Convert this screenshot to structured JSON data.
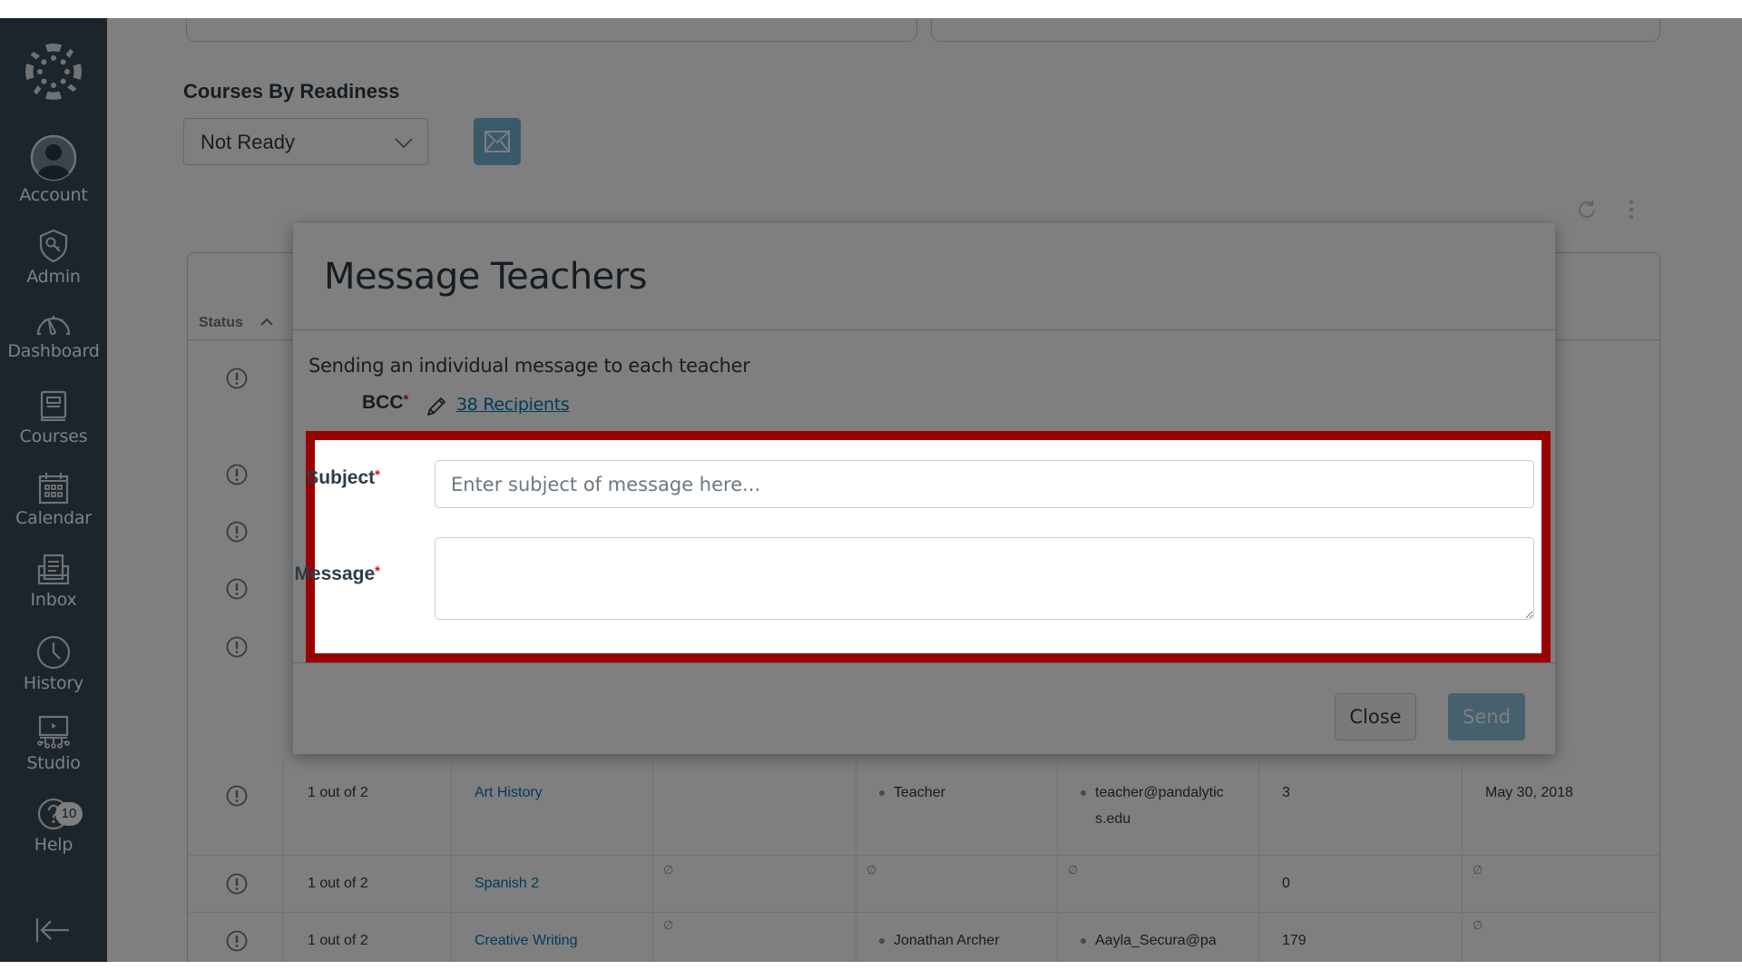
{
  "sidebar": {
    "logo_icon": "canvas-logo-icon",
    "items": [
      {
        "label": "Account",
        "icon": "account-icon"
      },
      {
        "label": "Admin",
        "icon": "admin-shield-icon"
      },
      {
        "label": "Dashboard",
        "icon": "dashboard-gauge-icon"
      },
      {
        "label": "Courses",
        "icon": "courses-book-icon"
      },
      {
        "label": "Calendar",
        "icon": "calendar-icon"
      },
      {
        "label": "Inbox",
        "icon": "inbox-icon"
      },
      {
        "label": "History",
        "icon": "history-clock-icon"
      },
      {
        "label": "Studio",
        "icon": "studio-icon"
      },
      {
        "label": "Help",
        "icon": "help-icon",
        "badge": "10"
      }
    ],
    "collapse_icon": "collapse-arrow-icon"
  },
  "main": {
    "section_title": "Courses By Readiness",
    "readiness_filter": {
      "selected": "Not Ready"
    },
    "email_button_icon": "envelope-icon",
    "toolbar_icons": [
      "refresh-icon",
      "more-vertical-icon"
    ],
    "table": {
      "sort_column": "Status",
      "sort_direction": "ascending",
      "rows": [
        {
          "status_icon": "warning-circle-icon",
          "readiness": "1 out of 2",
          "course": "Art History",
          "col4": "",
          "teachers": [
            "Teacher"
          ],
          "emails": [
            "teacher@pandalytics.edu"
          ],
          "students": "3",
          "date": "May 30, 2018"
        },
        {
          "status_icon": "warning-circle-icon",
          "readiness": "1 out of 2",
          "course": "Spanish 2",
          "col4": "∅",
          "teachers_empty": "∅",
          "emails_empty": "∅",
          "students": "0",
          "date": "∅"
        },
        {
          "status_icon": "warning-circle-icon",
          "readiness": "1 out of 2",
          "course": "Creative Writing",
          "col4": "∅",
          "teachers": [
            "Jonathan Archer"
          ],
          "emails": [
            "Aayla_Secura@pa"
          ],
          "students": "179",
          "date": "∅"
        }
      ]
    }
  },
  "modal": {
    "title": "Message Teachers",
    "description": "Sending an individual message to each teacher",
    "bcc": {
      "label": "BCC",
      "required_mark": "*",
      "edit_icon": "pencil-icon",
      "recipients_link": "38 Recipients"
    },
    "subject": {
      "label": "Subject",
      "required_mark": "*",
      "value": "",
      "placeholder": "Enter subject of message here..."
    },
    "message": {
      "label": "Message",
      "required_mark": "*",
      "value": ""
    },
    "buttons": {
      "close": "Close",
      "send": "Send"
    }
  },
  "highlight": {
    "color": "#990000",
    "target": "subject-and-message-fields"
  },
  "colors": {
    "sidebar_bg": "#394B58",
    "brand_blue": "#0374B5",
    "required_red": "#D01A19",
    "text_dark": "#2D3B45"
  }
}
